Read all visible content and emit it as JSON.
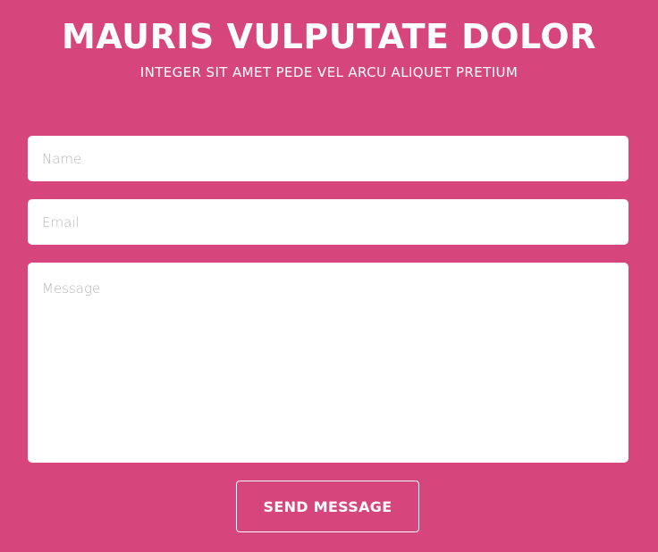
{
  "header": {
    "title": "MAURIS VULPUTATE DOLOR",
    "subtitle": "INTEGER SIT AMET PEDE VEL ARCU ALIQUET PRETIUM"
  },
  "form": {
    "name_placeholder": "Name",
    "email_placeholder": "Email",
    "message_placeholder": "Message",
    "name_value": "",
    "email_value": "",
    "message_value": "",
    "submit_label": "SEND MESSAGE"
  },
  "colors": {
    "background": "#d6467d",
    "field_background": "#ffffff",
    "placeholder": "#b8b8b8",
    "text": "#ffffff"
  }
}
